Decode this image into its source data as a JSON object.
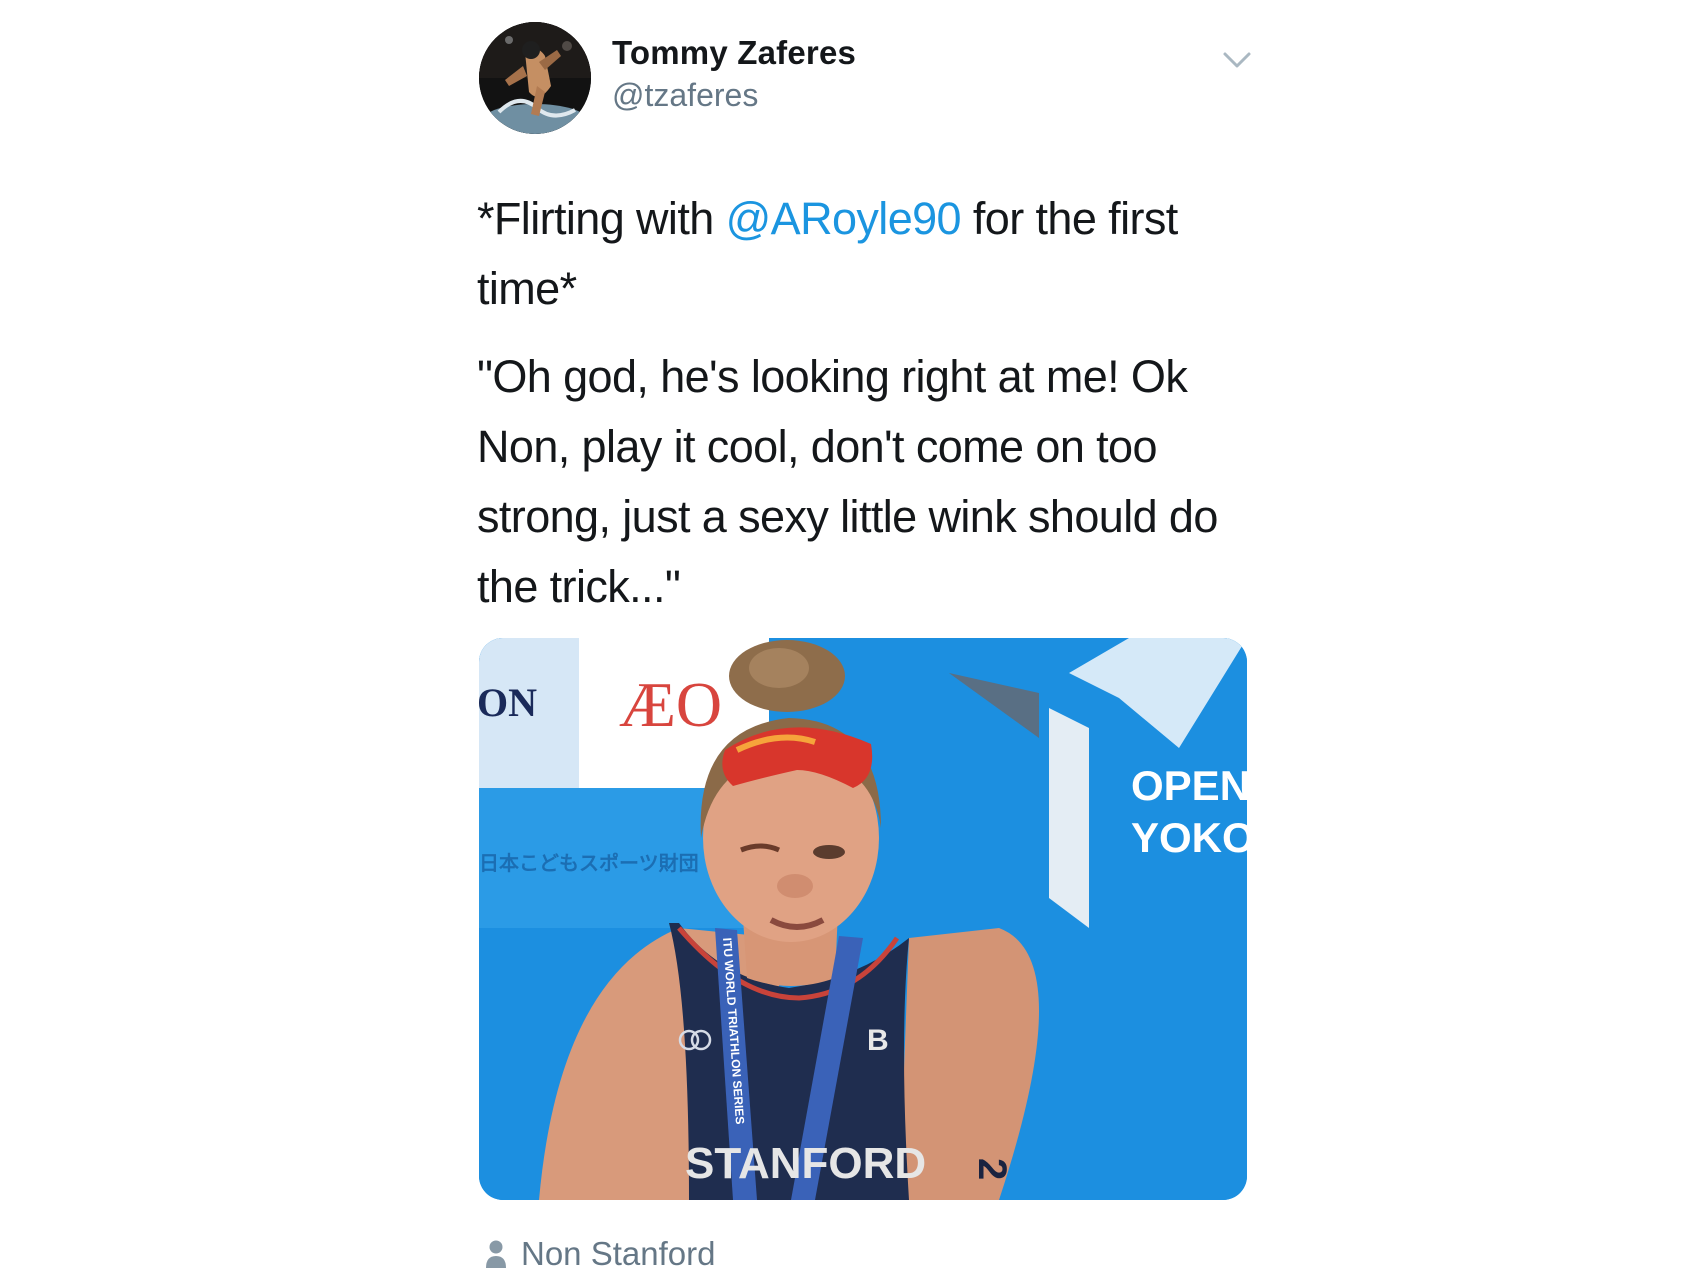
{
  "header": {
    "display_name": "Tommy Zaferes",
    "handle": "@tzaferes",
    "avatar_icon": "triathlete-avatar",
    "menu_icon": "chevron-down-icon"
  },
  "tweet": {
    "line1_prefix": "*Flirting with ",
    "mention": "@ARoyle90",
    "line1_suffix": " for the first time*",
    "paragraph2": "\"Oh god, he's looking right at me! Ok Non, play it cool, don't come on too strong, just a sexy little wink should do the trick...\""
  },
  "media": {
    "banner_left": "ON",
    "banner_logo": "ÆO",
    "banner_right_1": "OPEN",
    "banner_right_2": "YOKO",
    "japanese_banner": "日本こどもスポーツ財団",
    "lanyard_text": "ITU WORLD TRIATHLON SERIES",
    "suit_name": "STANFORD",
    "arm_number": "2"
  },
  "tagged": {
    "icon": "person-icon",
    "name": "Non Stanford"
  },
  "colors": {
    "text": "#14171a",
    "secondary": "#657786",
    "link": "#1b95e0",
    "photo_background": "#1c8fe0"
  }
}
